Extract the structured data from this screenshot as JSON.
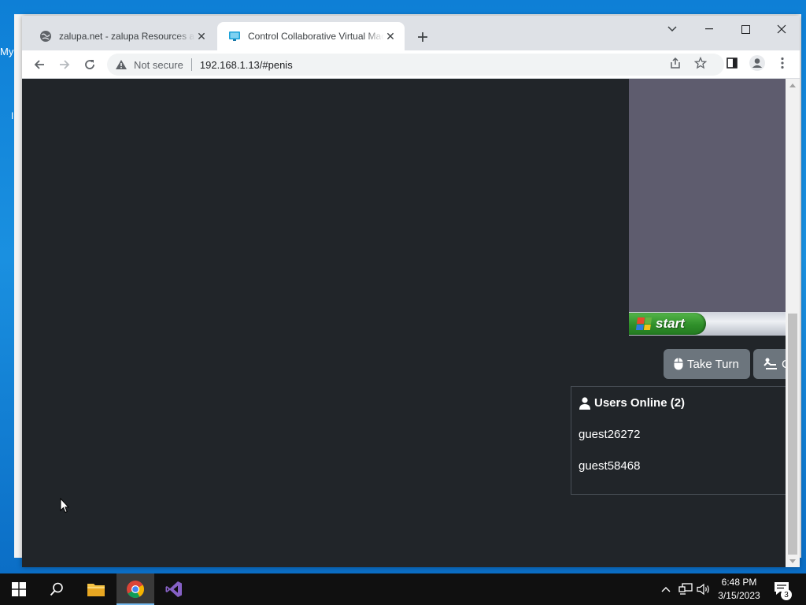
{
  "desktop": {
    "label_top": "My",
    "label_mid": "I"
  },
  "browser": {
    "tabs": [
      {
        "title": "zalupa.net - zalupa Resources and",
        "icon": "globe-icon"
      },
      {
        "title": "Control Collaborative Virtual Machine",
        "icon": "monitor-icon"
      }
    ],
    "address": {
      "security_label": "Not secure",
      "url": "192.168.1.13/#penis"
    }
  },
  "vm": {
    "start_label": "start"
  },
  "controls": {
    "take_turn_label": "Take Turn",
    "second_label": "C"
  },
  "users": {
    "header": "Users Online (2)",
    "list": [
      "guest26272",
      "guest58468"
    ]
  },
  "taskbar": {
    "time": "6:48 PM",
    "date": "3/15/2023",
    "notification_count": "3"
  },
  "colors": {
    "page_bg": "#212529",
    "button_bg": "#6c757d",
    "vm_screen": "#5e5c6e",
    "start_green": "#2f8f2a",
    "desktop_blue": "#0e7fd6"
  }
}
